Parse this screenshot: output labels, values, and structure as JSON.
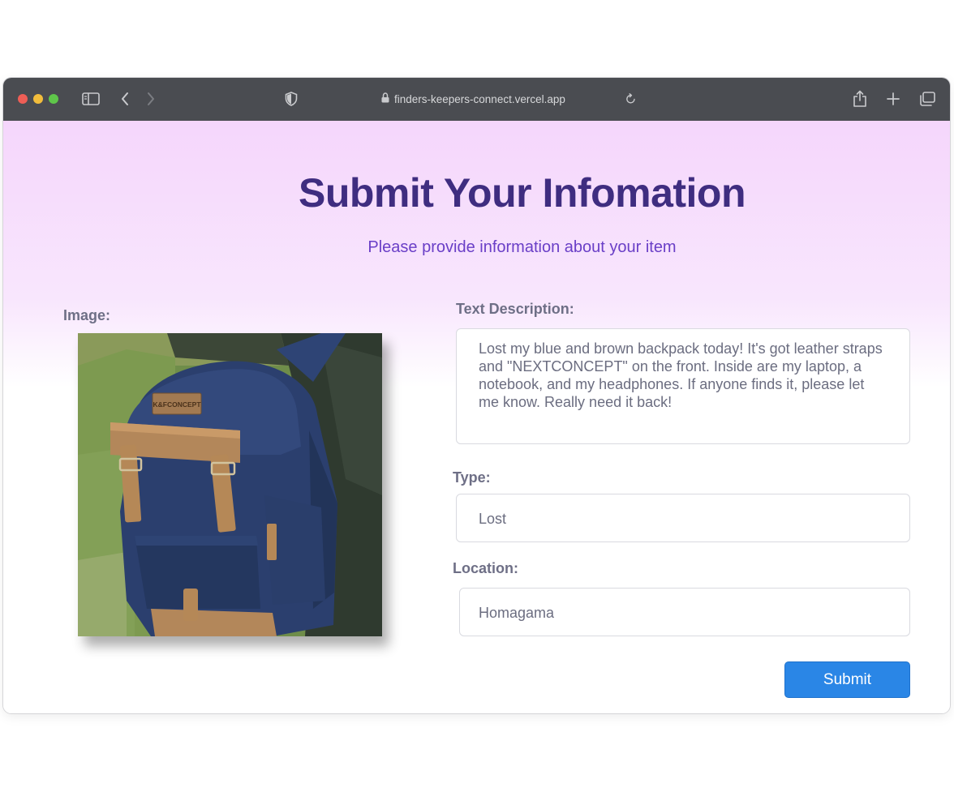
{
  "browser": {
    "url": "finders-keepers-connect.vercel.app",
    "icons": [
      "sidebar-icon",
      "back-icon",
      "forward-icon",
      "shield-icon",
      "lock-icon",
      "reload-icon",
      "share-icon",
      "new-tab-icon",
      "tabs-overview-icon"
    ]
  },
  "page": {
    "title": "Submit Your Infomation",
    "subtitle": "Please provide information about your item"
  },
  "form": {
    "image_label": "Image:",
    "description_label": "Text Description:",
    "description_value": "Lost my blue and brown backpack today!  It's got leather straps and \"NEXTCONCEPT\" on the front. Inside are my laptop, a notebook, and my headphones. If anyone finds it, please let me know. Really need it back!",
    "type_label": "Type:",
    "type_value": "Lost",
    "location_label": "Location:",
    "location_value": "Homagama",
    "submit_label": "Submit"
  },
  "image": {
    "brand_patch_text": "K&FCONCEPT"
  },
  "colors": {
    "title": "#3f2d80",
    "subtitle": "#6a3fc7",
    "submit_button": "#2a86e6",
    "gradient_top": "#f5d6fc"
  }
}
